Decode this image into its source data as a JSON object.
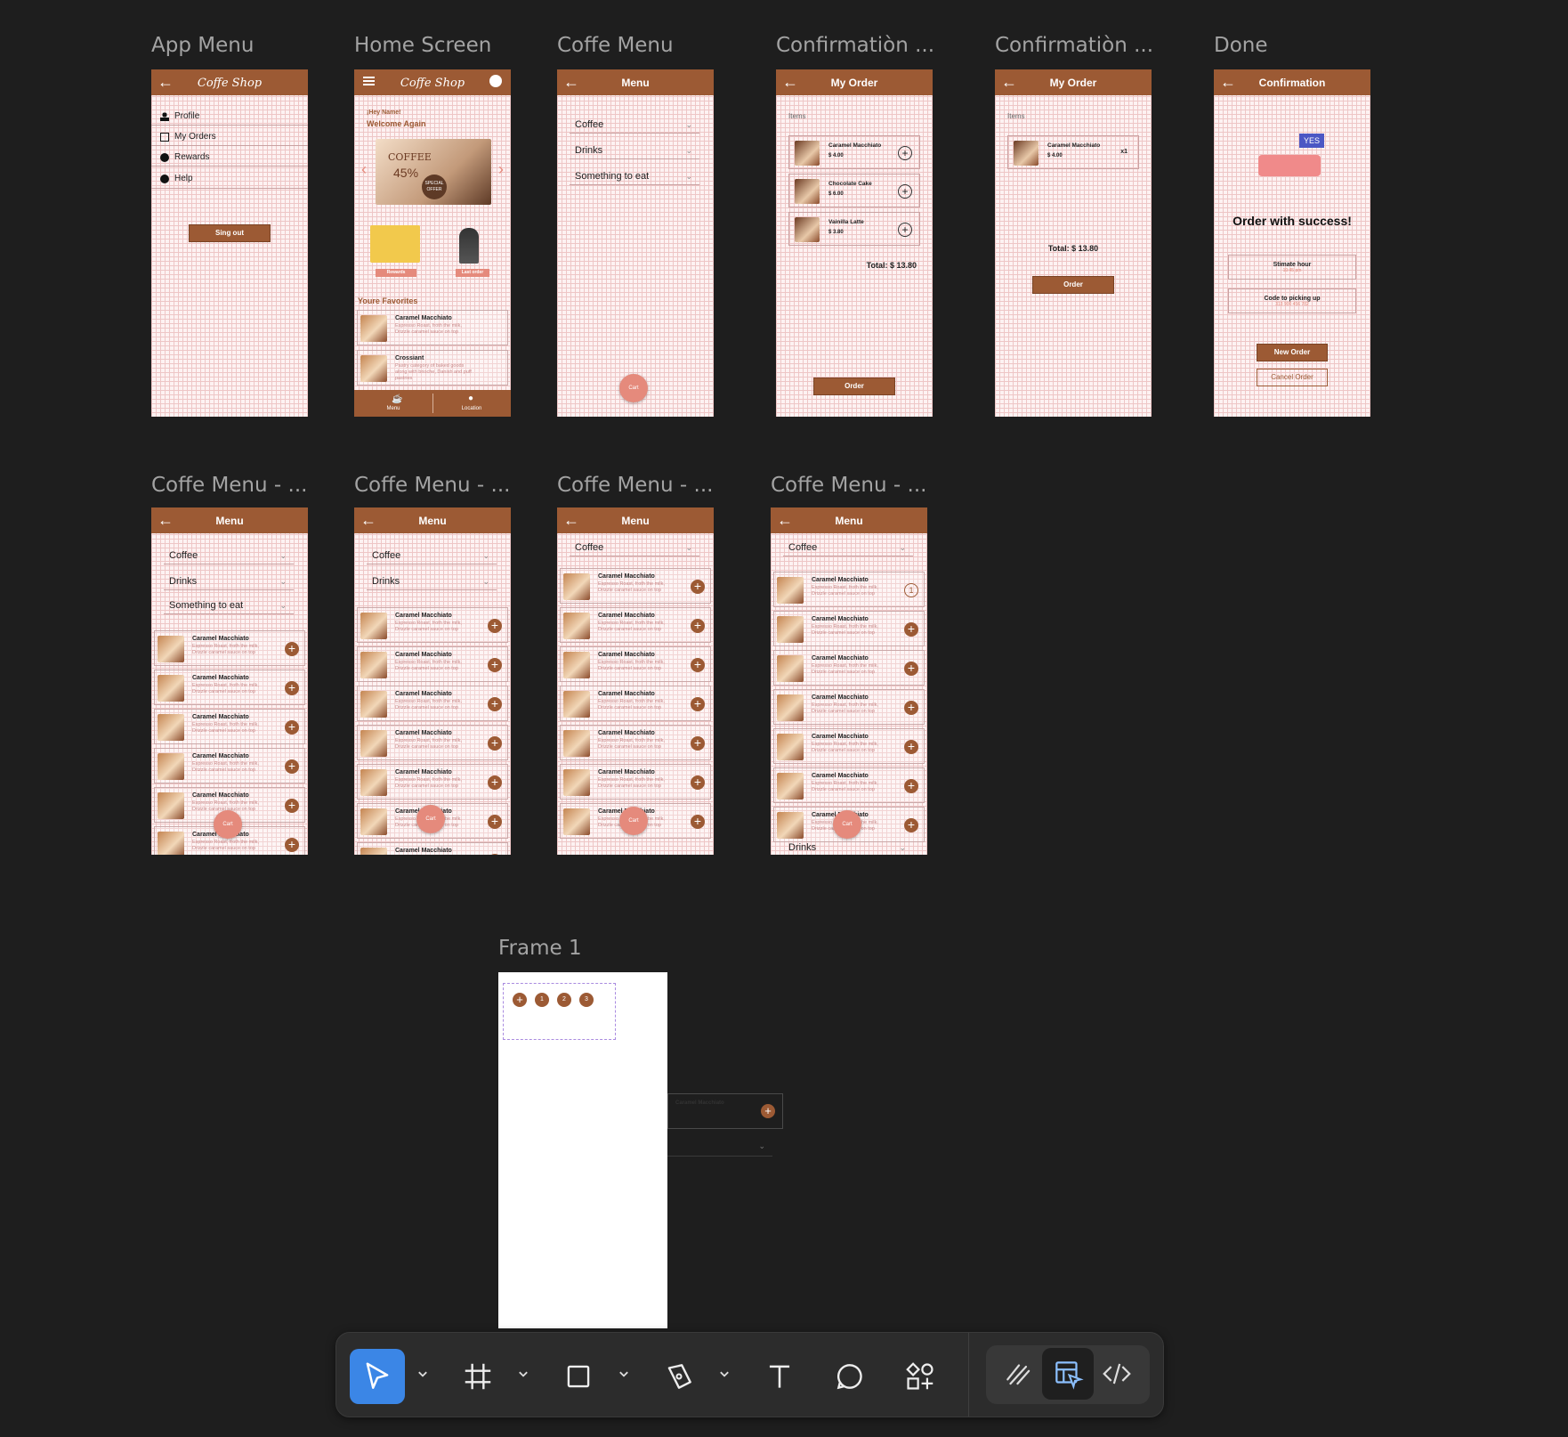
{
  "frames": {
    "app_menu": {
      "label": "App Menu",
      "title": "Coffe Shop",
      "items": [
        "Profile",
        "My Orders",
        "Rewards",
        "Help"
      ],
      "sign_out": "Sing out"
    },
    "home": {
      "label": "Home Screen",
      "title": "Coffe Shop",
      "greeting": "¡Hey Name!",
      "welcome": "Welcome Again",
      "banner_word": "COFFEE",
      "banner_pct": "45%",
      "banner_offer": "SPECIAL OFFER",
      "rewards": "Rewards",
      "last_order": "Last order",
      "favorites_title": "Youre Favorites",
      "favorites": [
        {
          "name": "Caramel Macchiato",
          "desc": "Espresso Roast, froth the milk, Drizzle caramel sauce on top"
        },
        {
          "name": "Crossiant",
          "desc": "Pastry category of baked goods along with brioche, Danish and puff pastries"
        }
      ],
      "nav": [
        "Menu",
        "Location"
      ]
    },
    "coffe_menu": {
      "label": "Coffe Menu",
      "title": "Menu",
      "dropdowns": [
        "Coffee",
        "Drinks",
        "Something to eat"
      ],
      "cart": "Cart"
    },
    "confirm1": {
      "label": "Confirmatiòn ...",
      "title": "My Order",
      "items_label": "Items",
      "items": [
        {
          "name": "Caramel Macchiato",
          "price": "$ 4.00"
        },
        {
          "name": "Chocolate Cake",
          "price": "$ 6.00"
        },
        {
          "name": "Vainilla Latte",
          "price": "$ 3.80"
        }
      ],
      "total": "Total: $ 13.80",
      "order": "Order"
    },
    "confirm2": {
      "label": "Confirmatiòn ...",
      "title": "My Order",
      "items_label": "Items",
      "item": {
        "name": "Caramel Macchiato",
        "price": "$ 4.00",
        "qty": "x1"
      },
      "total": "Total: $ 13.80",
      "order": "Order"
    },
    "done": {
      "label": "Done",
      "title": "Confirmation",
      "yes": "YES",
      "success": "Order with success!",
      "estimate": "Stimate hour",
      "estimate_val": "10:45 pm",
      "code": "Code to picking up",
      "code_val": "313 900 456 782",
      "new_order": "New Order",
      "cancel_order": "Cancel Order"
    },
    "variants": {
      "label": "Coffe Menu - ...",
      "title": "Menu",
      "item_name": "Caramel Macchiato",
      "item_desc": "Espresso Roast, froth the milk, Drizzle caramel sauce on top",
      "coffee": "Coffee",
      "drinks": "Drinks",
      "something": "Something to eat",
      "cart": "Cart",
      "qty": "1"
    },
    "frame1": {
      "label": "Frame 1",
      "steps": [
        "+",
        "1",
        "2",
        "3"
      ],
      "item_name": "Caramel Macchiato"
    }
  },
  "toolbar": {
    "tools": [
      "move-tool",
      "frame-tool",
      "rectangle-tool",
      "pen-tool",
      "text-tool",
      "comment-tool",
      "components-tool"
    ],
    "modes": [
      "draw-mode",
      "design-mode",
      "dev-mode"
    ],
    "active": "move-tool",
    "accent": "#3b86e6"
  }
}
